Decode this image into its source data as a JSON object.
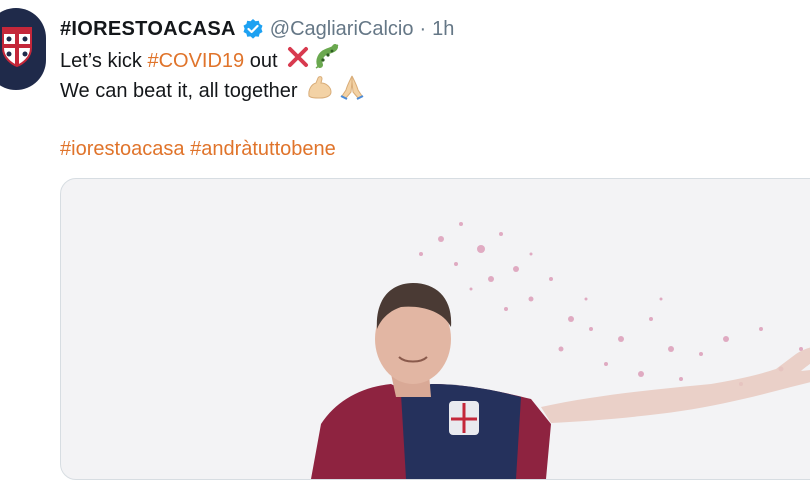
{
  "tweet": {
    "display_name": "#IORESTOACASA",
    "handle": "@CagliariCalcio",
    "separator": "·",
    "time": "1h",
    "line1_prefix": "Let’s kick ",
    "line1_hashtag": "#COVID19",
    "line1_suffix": " out",
    "line2": "We can beat it, all together",
    "hashtag1": "#iorestoacasa",
    "hashtag2": "#andràtuttobene"
  },
  "icons": {
    "avatar": "cagliari-crest-icon",
    "verified": "verified-badge-icon",
    "cross": "cross-mark-icon",
    "virus": "microbe-icon",
    "muscle": "flexed-biceps-icon",
    "pray": "folded-hands-icon"
  },
  "colors": {
    "hashtag": "#e0742b",
    "verified": "#1da1f2",
    "cross": "#d83a4f",
    "virus": "#6aa84f",
    "avatar_bg": "#1f2a4a",
    "jersey_red": "#8e2340",
    "jersey_blue": "#25315c",
    "splatter": "#d06f98"
  }
}
